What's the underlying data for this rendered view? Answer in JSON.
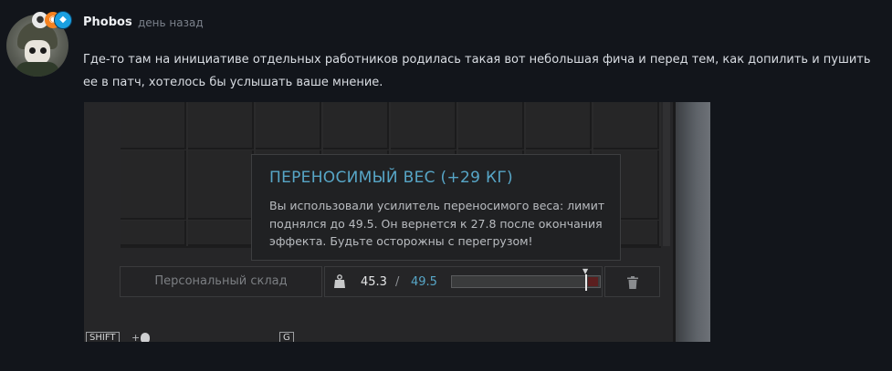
{
  "post": {
    "author": "Phobos",
    "time": "день назад",
    "message": "Где-то там на инициативе отдельных работников родилась такая вот небольшая фича и перед тем, как допилить и пушить ее в патч, хотелось бы услышать ваше мнение."
  },
  "avatar": {
    "badges": [
      "badge-white-icon",
      "badge-orange-icon",
      "diamond-icon"
    ]
  },
  "game": {
    "tooltip": {
      "title": "ПЕРЕНОСИМЫЙ ВЕС (+29 КГ)",
      "body": "Вы использовали усилитель переносимого веса: лимит поднялся до 49.5. Он вернется к 27.8 после окончания эффекта. Будьте осторожны с перегрузом!"
    },
    "stash": {
      "label": "Персональный склад",
      "weight_current": "45.3",
      "separator": "/",
      "weight_max": "49.5",
      "base_limit": 27.8,
      "current": 45.3,
      "max": 49.5
    },
    "hints": [
      {
        "key": "SHIFT",
        "text": "+"
      },
      {
        "key": "G",
        "text": ""
      }
    ]
  },
  "colors": {
    "accent": "#57a6c7",
    "over": "#5b1f1f",
    "page_bg": "#12151b"
  }
}
